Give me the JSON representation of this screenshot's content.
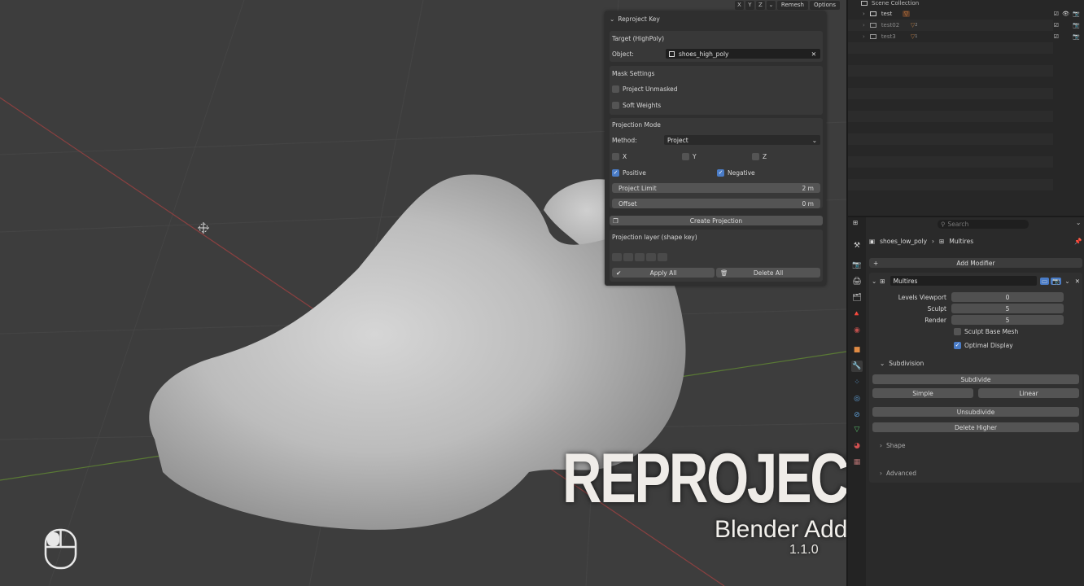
{
  "viewport_header": {
    "axes": [
      "X",
      "Y",
      "Z"
    ],
    "remesh": "Remesh",
    "options": "Options"
  },
  "reproject_panel": {
    "title": "Reproject Key",
    "target": {
      "header": "Target (HighPoly)",
      "object_label": "Object:",
      "object_value": "shoes_high_poly"
    },
    "mask": {
      "header": "Mask Settings",
      "project_unmasked": "Project Unmasked",
      "soft_weights": "Soft Weights"
    },
    "projection": {
      "header": "Projection Mode",
      "method_label": "Method:",
      "method_value": "Project",
      "x": "X",
      "y": "Y",
      "z": "Z",
      "positive": "Positive",
      "negative": "Negative",
      "limit_label": "Project Limit",
      "limit_value": "2 m",
      "offset_label": "Offset",
      "offset_value": "0 m"
    },
    "create_button": "Create Projection",
    "layer": {
      "header": "Projection layer (shape key)",
      "apply_all": "Apply All",
      "delete_all": "Delete All"
    }
  },
  "outliner": {
    "root": "Scene Collection",
    "items": [
      {
        "name": "test",
        "sub": ""
      },
      {
        "name": "test02",
        "sub": "2"
      },
      {
        "name": "test3",
        "sub": "1"
      }
    ]
  },
  "properties": {
    "search_placeholder": "Search",
    "breadcrumb_object": "shoes_low_poly",
    "breadcrumb_modifier": "Multires",
    "add_modifier": "Add Modifier",
    "modifier_name": "Multires",
    "levels_viewport_label": "Levels Viewport",
    "levels_viewport_value": "0",
    "sculpt_label": "Sculpt",
    "sculpt_value": "5",
    "render_label": "Render",
    "render_value": "5",
    "sculpt_base_mesh": "Sculpt Base Mesh",
    "optimal_display": "Optimal Display",
    "subdivision_header": "Subdivision",
    "subdivide": "Subdivide",
    "simple": "Simple",
    "linear": "Linear",
    "unsubdivide": "Unsubdivide",
    "delete_higher": "Delete Higher",
    "shape_header": "Shape",
    "advanced_header": "Advanced"
  },
  "overlay": {
    "title": "REPROJECT KEY",
    "subtitle": "Blender Addon",
    "version": "1.1.0"
  }
}
